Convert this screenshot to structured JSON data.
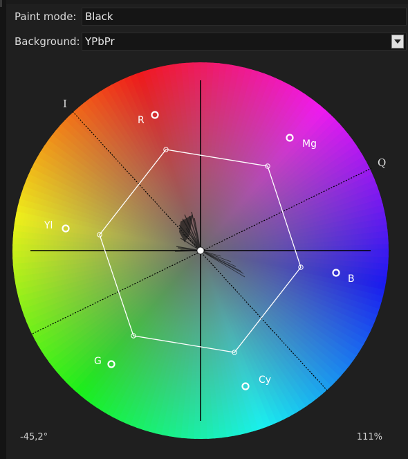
{
  "paint_mode": {
    "label": "Paint mode:",
    "value": "Black"
  },
  "background": {
    "label": "Background:",
    "value": "YPbPr"
  },
  "scope": {
    "axis_labels": {
      "i": "I",
      "q": "Q"
    },
    "targets": {
      "r": "R",
      "mg": "Mg",
      "b": "B",
      "cy": "Cy",
      "g": "G",
      "yl": "Yl"
    },
    "angle_readout": "-45,2°",
    "zoom_readout": "111%"
  },
  "colors": {
    "panel_bg": "#1f1f1f",
    "graticule": "#ffffff",
    "axis_line": "#000000"
  }
}
